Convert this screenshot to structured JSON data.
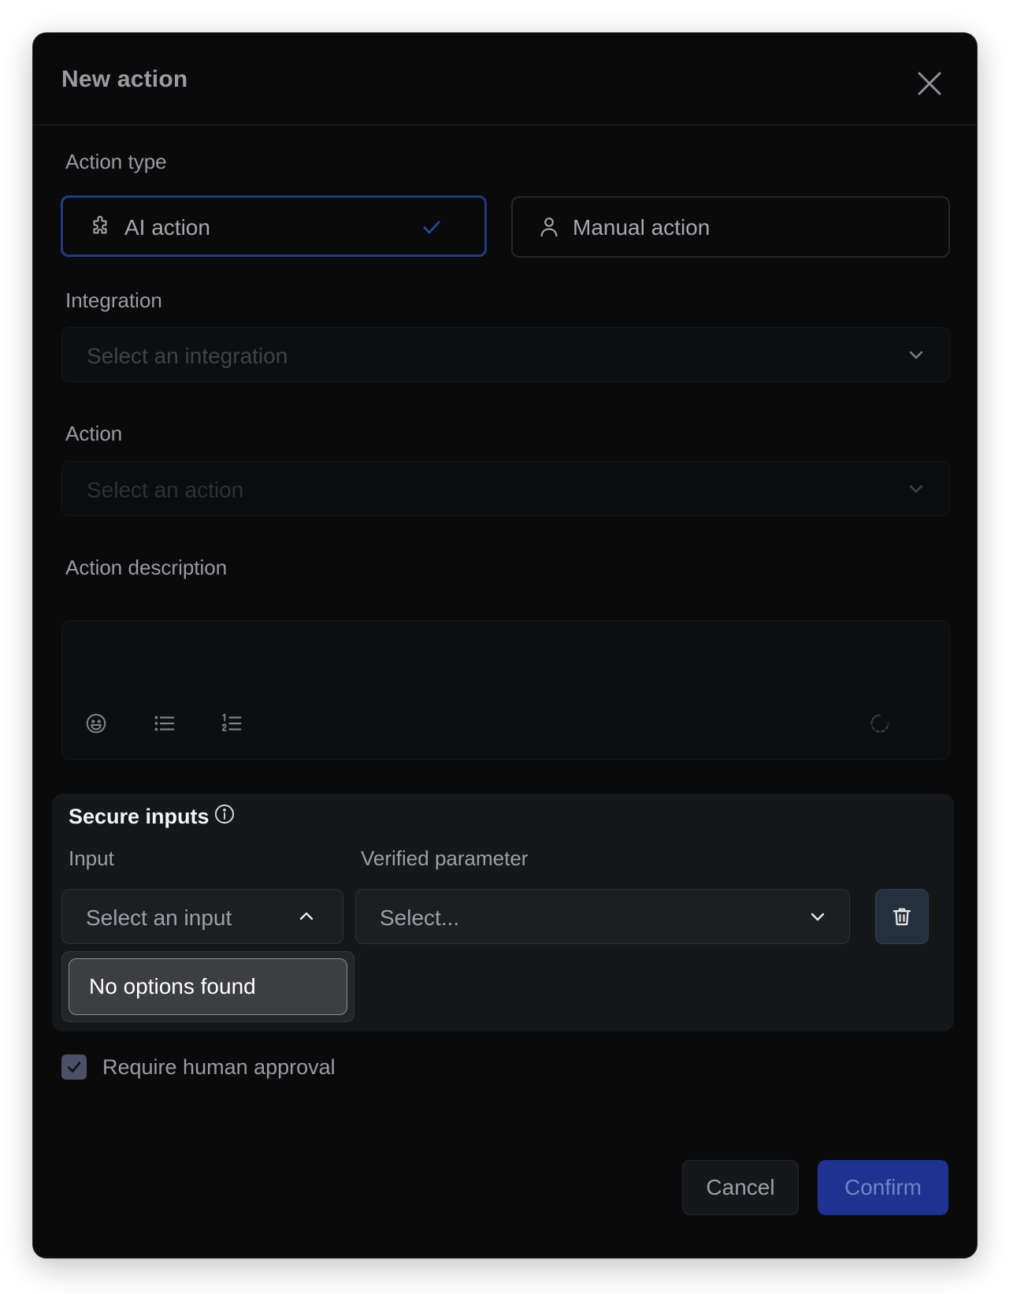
{
  "dialog": {
    "title": "New action"
  },
  "action_type": {
    "label": "Action type",
    "options": [
      {
        "label": "AI action",
        "icon": "puzzle-icon",
        "selected": true
      },
      {
        "label": "Manual action",
        "icon": "user-icon",
        "selected": false
      }
    ]
  },
  "integration": {
    "label": "Integration",
    "placeholder": "Select an integration"
  },
  "action": {
    "label": "Action",
    "placeholder": "Select an action"
  },
  "description": {
    "label": "Action description",
    "toolbar": [
      "emoji-icon",
      "bullet-list-icon",
      "numbered-list-icon",
      "loading-icon"
    ]
  },
  "secure_inputs": {
    "title": "Secure inputs",
    "input_label": "Input",
    "param_label": "Verified parameter",
    "input_placeholder": "Select an input",
    "param_placeholder": "Select...",
    "dropdown_empty": "No options found"
  },
  "approval": {
    "label": "Require human approval",
    "checked": true
  },
  "footer": {
    "cancel": "Cancel",
    "confirm": "Confirm"
  },
  "colors": {
    "accent_border": "#233a82",
    "confirm_bg": "#1e3390",
    "dialog_bg": "#0a0a0b"
  }
}
